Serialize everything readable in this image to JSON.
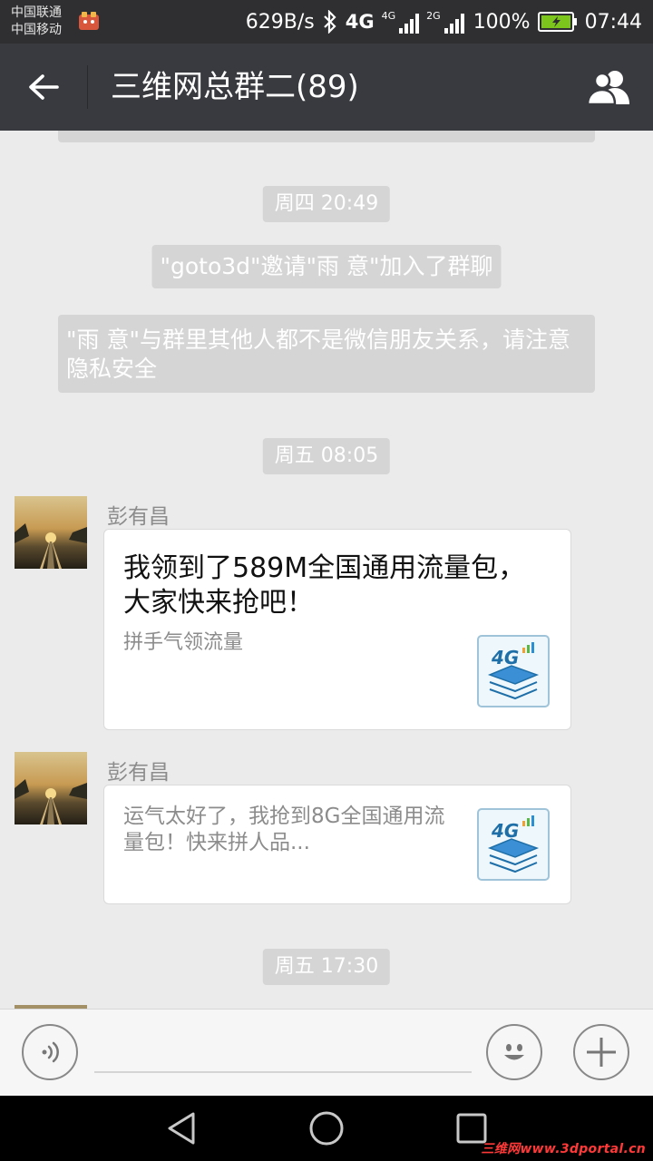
{
  "status_bar": {
    "carrier_1": "中国联通",
    "carrier_2": "中国移动",
    "net_speed": "629B/s",
    "net_type_1": "4G",
    "net_type_2": "4G",
    "net_type_3": "2G",
    "battery": "100%",
    "time": "07:44"
  },
  "header": {
    "title": "三维网总群二(89)",
    "back_icon": "arrow-left-icon",
    "members_icon": "group-members-icon"
  },
  "chat": {
    "timestamp_1": "周四 20:49",
    "system_invite": "\"goto3d\"邀请\"雨 意\"加入了群聊",
    "system_privacy": "\"雨 意\"与群里其他人都不是微信朋友关系，请注意隐私安全",
    "timestamp_2": "周五 08:05",
    "messages": [
      {
        "sender": "彭有昌",
        "title": "我领到了589M全国通用流量包，大家快来抢吧！",
        "desc": "拼手气领流量",
        "thumb_badge": "4G"
      },
      {
        "sender": "彭有昌",
        "desc": "运气太好了，我抢到8G全国通用流量包！快来拼人品...",
        "thumb_badge": "4G"
      }
    ],
    "timestamp_3": "周五 17:30"
  },
  "input_bar": {
    "voice_icon": "voice-icon",
    "emoji_icon": "emoji-icon",
    "plus_icon": "plus-icon",
    "placeholder": ""
  },
  "nav_bar": {
    "back_icon": "nav-back-icon",
    "home_icon": "nav-home-icon",
    "recents_icon": "nav-recents-icon"
  },
  "watermark": "三维网www.3dportal.cn",
  "colors": {
    "status_bar_bg": "#2f2f31",
    "title_bar_bg": "#393a3f",
    "chat_bg": "#ebebeb",
    "system_bubble_bg": "#d5d5d5",
    "watermark": "#ff3838"
  }
}
